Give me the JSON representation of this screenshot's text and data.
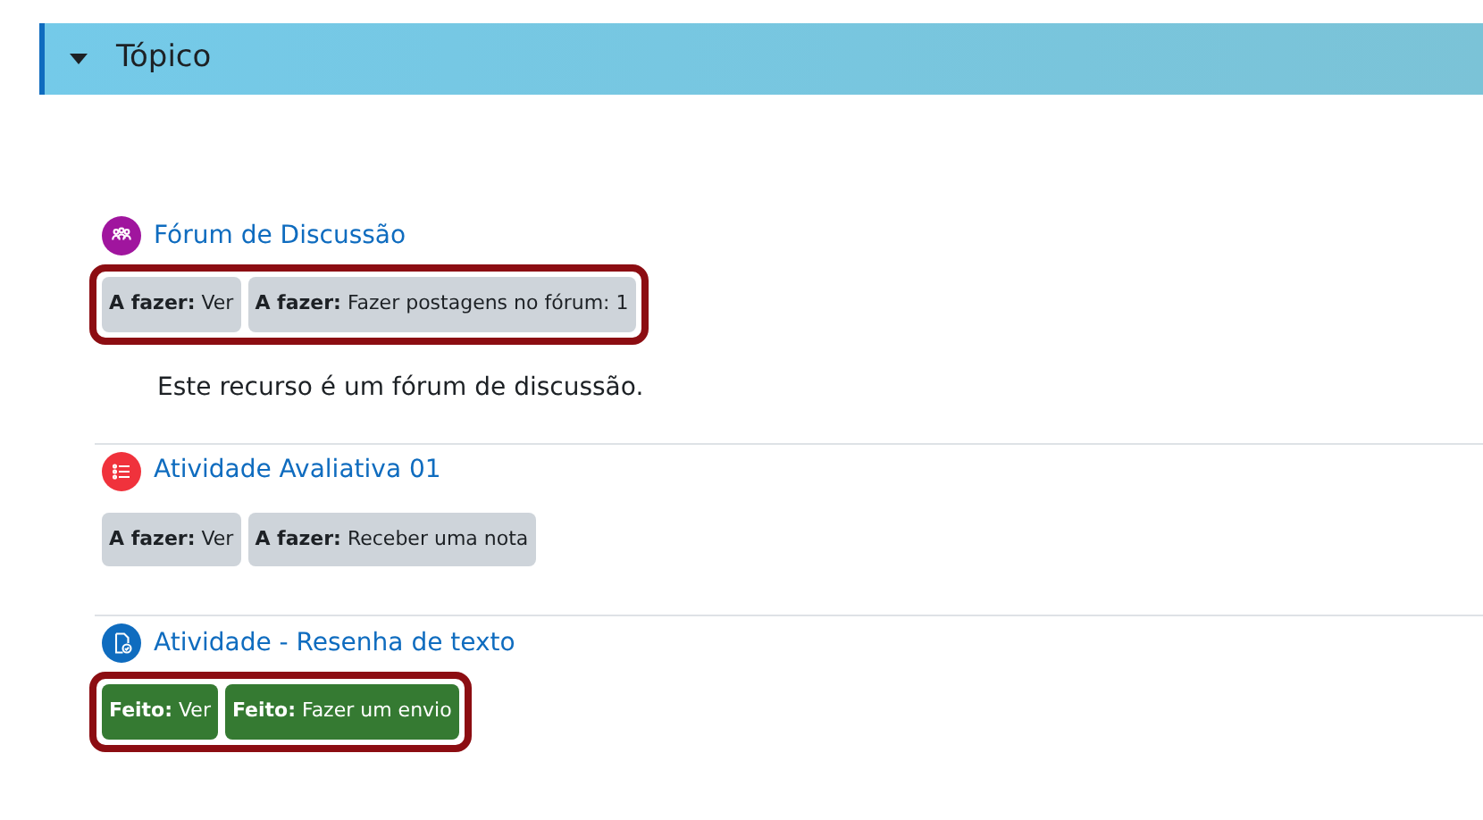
{
  "section": {
    "title": "Tópico",
    "expanded": true
  },
  "activities": [
    {
      "kind": "forum",
      "color": "#a0159e",
      "title": "Fórum de Discussão",
      "highlighted": true,
      "badges": [
        {
          "text": "**A fazer:** Ver",
          "done": false
        },
        {
          "text": "**A fazer:** Fazer postagens no fórum: 1",
          "done": false
        }
      ],
      "description": "Este recurso é um fórum de discussão."
    },
    {
      "kind": "quiz",
      "color": "#f0323c",
      "title": "Atividade Avaliativa 01",
      "highlighted": false,
      "badges": [
        {
          "text": "**A fazer:** Ver",
          "done": false
        },
        {
          "text": "**A fazer:** Receber uma nota",
          "done": false
        }
      ]
    },
    {
      "kind": "assign",
      "color": "#0f6cbf",
      "title": "Atividade - Resenha de texto",
      "highlighted": true,
      "badges": [
        {
          "text": "**Feito:** Ver",
          "done": true
        },
        {
          "text": "**Feito:** Fazer um envio",
          "done": true
        }
      ]
    }
  ]
}
